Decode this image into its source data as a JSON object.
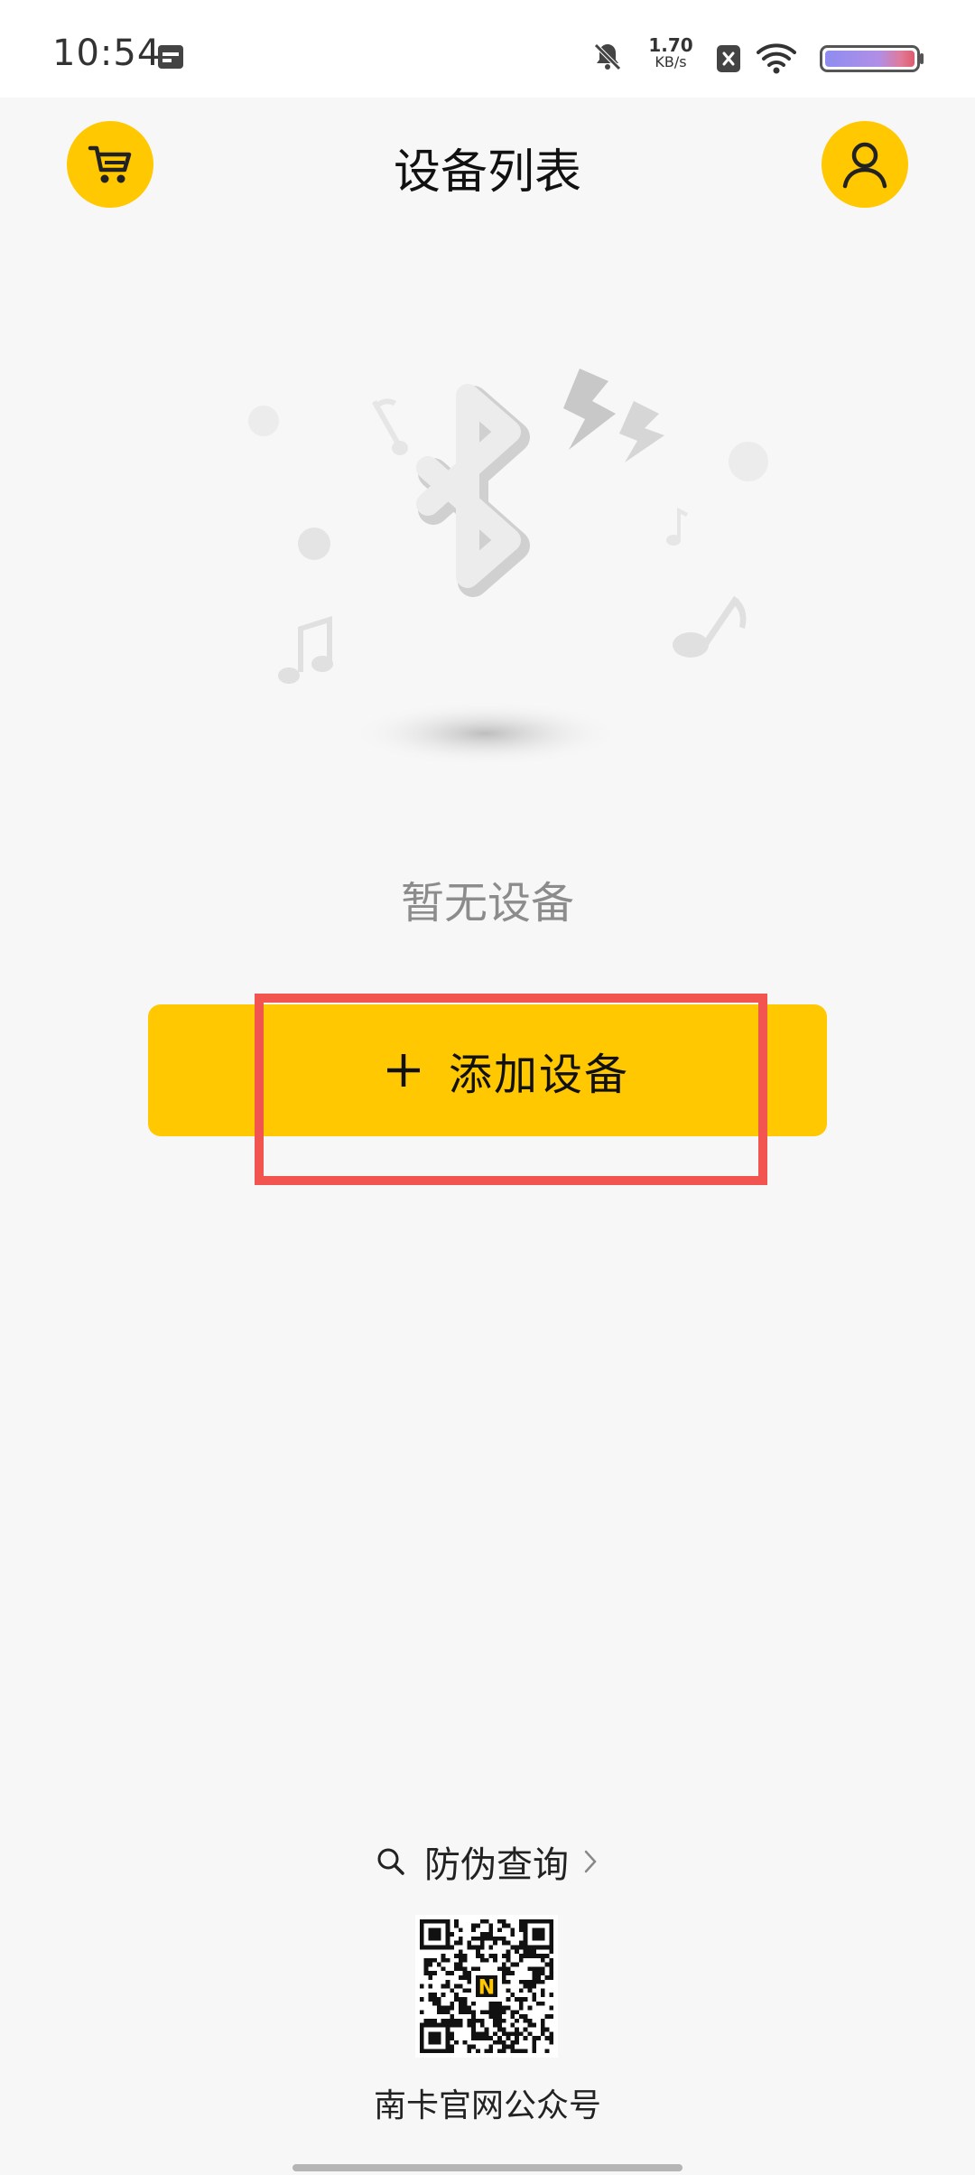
{
  "status_bar": {
    "time": "10:54",
    "net_speed_value": "1.70",
    "net_speed_unit": "KB/s",
    "icons": [
      "calendar-icon",
      "bell-muted-icon",
      "sim-x-icon",
      "wifi-icon",
      "battery-icon"
    ]
  },
  "header": {
    "title": "设备列表",
    "left_icon": "cart-icon",
    "right_icon": "user-icon"
  },
  "empty_state": {
    "message": "暂无设备",
    "illustration_icon": "bluetooth-icon"
  },
  "add_device": {
    "label": "添加设备",
    "icon": "plus-icon"
  },
  "anti_counterfeit": {
    "label": "防伪查询",
    "icon": "search-icon",
    "chevron": "chevron-right-icon"
  },
  "official_account": {
    "caption": "南卡官网公众号",
    "qr_center_letter": "N"
  },
  "colors": {
    "accent": "#ffc800",
    "background": "#f7f7f7",
    "highlight": "#f2554f",
    "muted_text": "#8c8c8c"
  }
}
